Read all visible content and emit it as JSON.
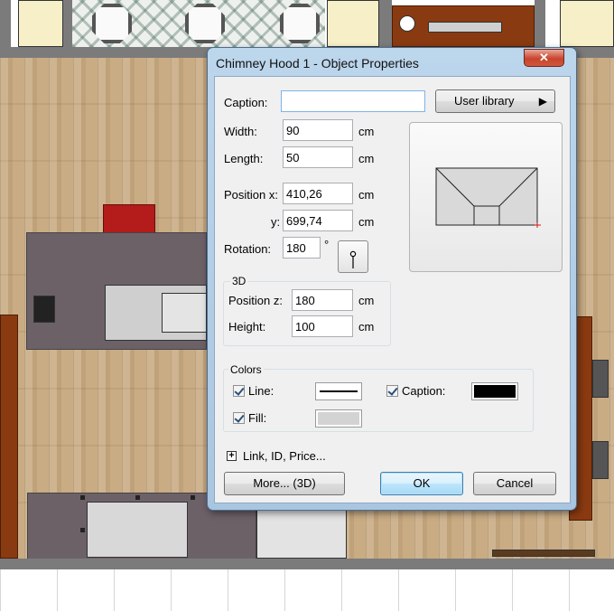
{
  "dialog": {
    "title": "Chimney Hood 1 - Object Properties",
    "close_glyph": "✕"
  },
  "fields": {
    "caption_label": "Caption:",
    "caption_value": "",
    "user_library_label": "User library",
    "user_library_arrow": "▶",
    "width_label": "Width:",
    "width_value": "90",
    "width_unit": "cm",
    "length_label": "Length:",
    "length_value": "50",
    "length_unit": "cm",
    "position_x_label": "Position x:",
    "position_x_value": "410,26",
    "position_x_unit": "cm",
    "position_y_label": "y:",
    "position_y_value": "699,74",
    "position_y_unit": "cm",
    "rotation_label": "Rotation:",
    "rotation_value": "180",
    "rotation_unit": "°"
  },
  "group_3d": {
    "legend": "3D",
    "position_z_label": "Position  z:",
    "position_z_value": "180",
    "position_z_unit": "cm",
    "height_label": "Height:",
    "height_value": "100",
    "height_unit": "cm"
  },
  "colors": {
    "legend": "Colors",
    "line_label": "Line:",
    "line_checked": true,
    "caption_label": "Caption:",
    "caption_checked": true,
    "caption_color": "#000000",
    "fill_label": "Fill:",
    "fill_checked": true,
    "fill_color": "#d3d3d3"
  },
  "expander": {
    "glyph": "+",
    "label": "Link, ID, Price..."
  },
  "buttons": {
    "more_label": "More... (3D)",
    "ok_label": "OK",
    "cancel_label": "Cancel"
  }
}
